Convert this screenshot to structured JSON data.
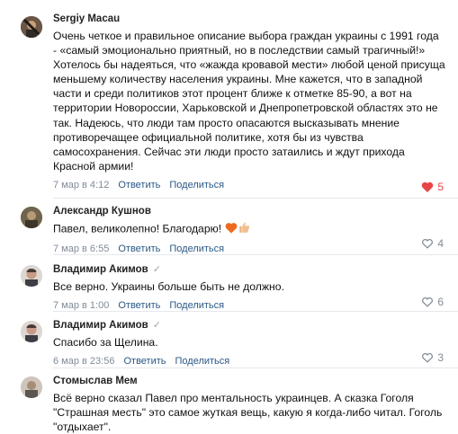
{
  "comments": [
    {
      "author": "Sergiy Macau",
      "verified": false,
      "text": "Очень четкое и правильное описание выбора граждан украины с 1991 года - «самый эмоционально приятный, но в последствии самый трагичный!» Хотелось бы надеяться, что «жажда кровавой мести» любой ценой присуща меньшему количеству населения украины. Мне кажется, что в западной части и среди политиков этот процент ближе к отметке 85-90, а вот на территории Новороссии, Харьковской и Днепропетровской областях это не так. Надеюсь, что люди там просто опасаются высказывать мнение противоречащее официальной политике, хотя бы из чувства самосохранения. Сейчас эти люди просто затаились и ждут прихода Красной армии!",
      "date": "7 мар в 4:12",
      "reply": "Ответить",
      "share": "Поделиться",
      "likes": "5"
    },
    {
      "author": "Александр Кушнов",
      "verified": false,
      "text": "Павел, великолепно! Благодарю!",
      "date": "7 мар в 6:55",
      "reply": "Ответить",
      "share": "Поделиться",
      "likes": "4"
    },
    {
      "author": "Владимир Акимов",
      "verified": true,
      "text": "Все верно. Украины больше быть не должно.",
      "date": "7 мар в 1:00",
      "reply": "Ответить",
      "share": "Поделиться",
      "likes": "6"
    },
    {
      "author": "Владимир Акимов",
      "verified": true,
      "text": "Спасибо за Щелина.",
      "date": "6 мар в 23:56",
      "reply": "Ответить",
      "share": "Поделиться",
      "likes": "3"
    },
    {
      "author": "Стомыслав Мем",
      "verified": false,
      "text": "Всё верно сказал Павел про ментальность украинцев. А сказка Гоголя \"Страшная месть\" это самое жуткая вещь, какую я когда-либо читал. Гоголь \"отдыхает\".",
      "date": "",
      "reply": "",
      "share": "",
      "likes": ""
    }
  ],
  "colors": {
    "link": "#2a5885",
    "like_active": "#e64646",
    "meta": "#818c99"
  },
  "icons": {
    "like": "heart-icon",
    "verified": "checkmark-icon",
    "emoji": [
      "heart-emoji",
      "thumbs-up-emoji"
    ]
  }
}
